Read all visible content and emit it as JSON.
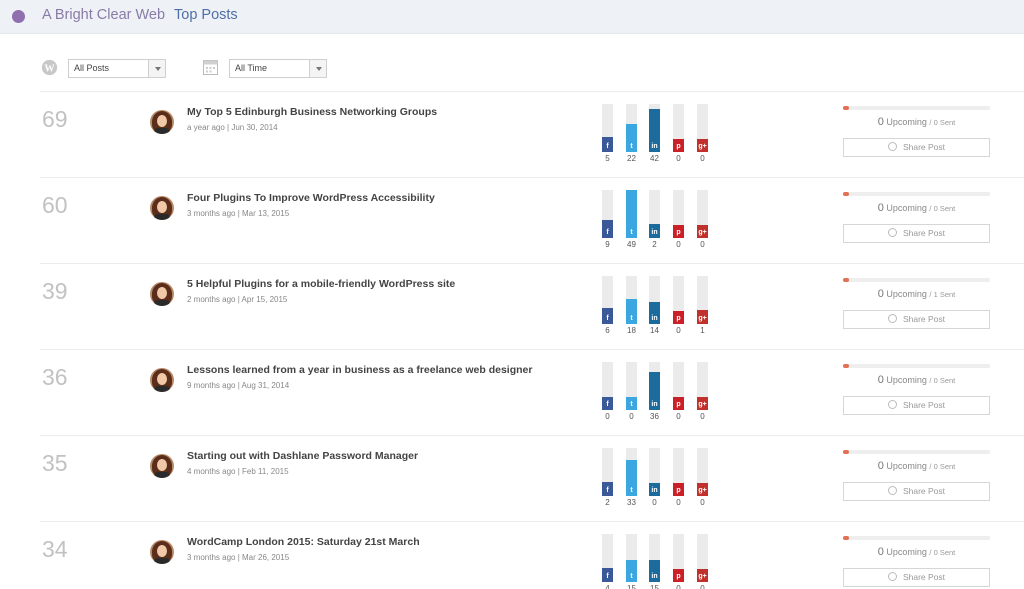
{
  "header": {
    "site_name": "A Bright Clear Web",
    "page_title": "Top Posts"
  },
  "filters": {
    "posts_label": "All Posts",
    "time_label": "All Time"
  },
  "colors": {
    "facebook": "#3b5998",
    "twitter": "#3aa7e0",
    "linkedin": "#1b6c9d",
    "pinterest": "#cb2027",
    "googleplus": "#c1302a",
    "progress": "#e27154"
  },
  "icons": {
    "facebook": "f",
    "twitter": "t",
    "linkedin": "in",
    "pinterest": "p",
    "googleplus": "g+"
  },
  "bar_scale_max": 49,
  "share_button_label": "Share Post",
  "upcoming_word": "Upcoming",
  "posts": [
    {
      "rank": "69",
      "title": "My Top 5 Edinburgh Business Networking Groups",
      "meta": "a year ago | Jun 30, 2014",
      "shares": {
        "facebook": 5,
        "twitter": 22,
        "linkedin": 42,
        "pinterest": 0,
        "googleplus": 0
      },
      "upcoming": "0",
      "sent": "/ 0 Sent"
    },
    {
      "rank": "60",
      "title": "Four Plugins To Improve WordPress Accessibility",
      "meta": "3 months ago | Mar 13, 2015",
      "shares": {
        "facebook": 9,
        "twitter": 49,
        "linkedin": 2,
        "pinterest": 0,
        "googleplus": 0
      },
      "upcoming": "0",
      "sent": "/ 0 Sent"
    },
    {
      "rank": "39",
      "title": "5 Helpful Plugins for a mobile-friendly WordPress site",
      "meta": "2 months ago | Apr 15, 2015",
      "shares": {
        "facebook": 6,
        "twitter": 18,
        "linkedin": 14,
        "pinterest": 0,
        "googleplus": 1
      },
      "upcoming": "0",
      "sent": "/ 1 Sent"
    },
    {
      "rank": "36",
      "title": "Lessons learned from a year in business as a freelance web designer",
      "meta": "9 months ago | Aug 31, 2014",
      "shares": {
        "facebook": 0,
        "twitter": 0,
        "linkedin": 36,
        "pinterest": 0,
        "googleplus": 0
      },
      "upcoming": "0",
      "sent": "/ 0 Sent"
    },
    {
      "rank": "35",
      "title": "Starting out with Dashlane Password Manager",
      "meta": "4 months ago | Feb 11, 2015",
      "shares": {
        "facebook": 2,
        "twitter": 33,
        "linkedin": 0,
        "pinterest": 0,
        "googleplus": 0
      },
      "upcoming": "0",
      "sent": "/ 0 Sent"
    },
    {
      "rank": "34",
      "title": "WordCamp London 2015: Saturday 21st March",
      "meta": "3 months ago | Mar 26, 2015",
      "shares": {
        "facebook": 4,
        "twitter": 15,
        "linkedin": 15,
        "pinterest": 0,
        "googleplus": 0
      },
      "upcoming": "0",
      "sent": "/ 0 Sent"
    }
  ]
}
